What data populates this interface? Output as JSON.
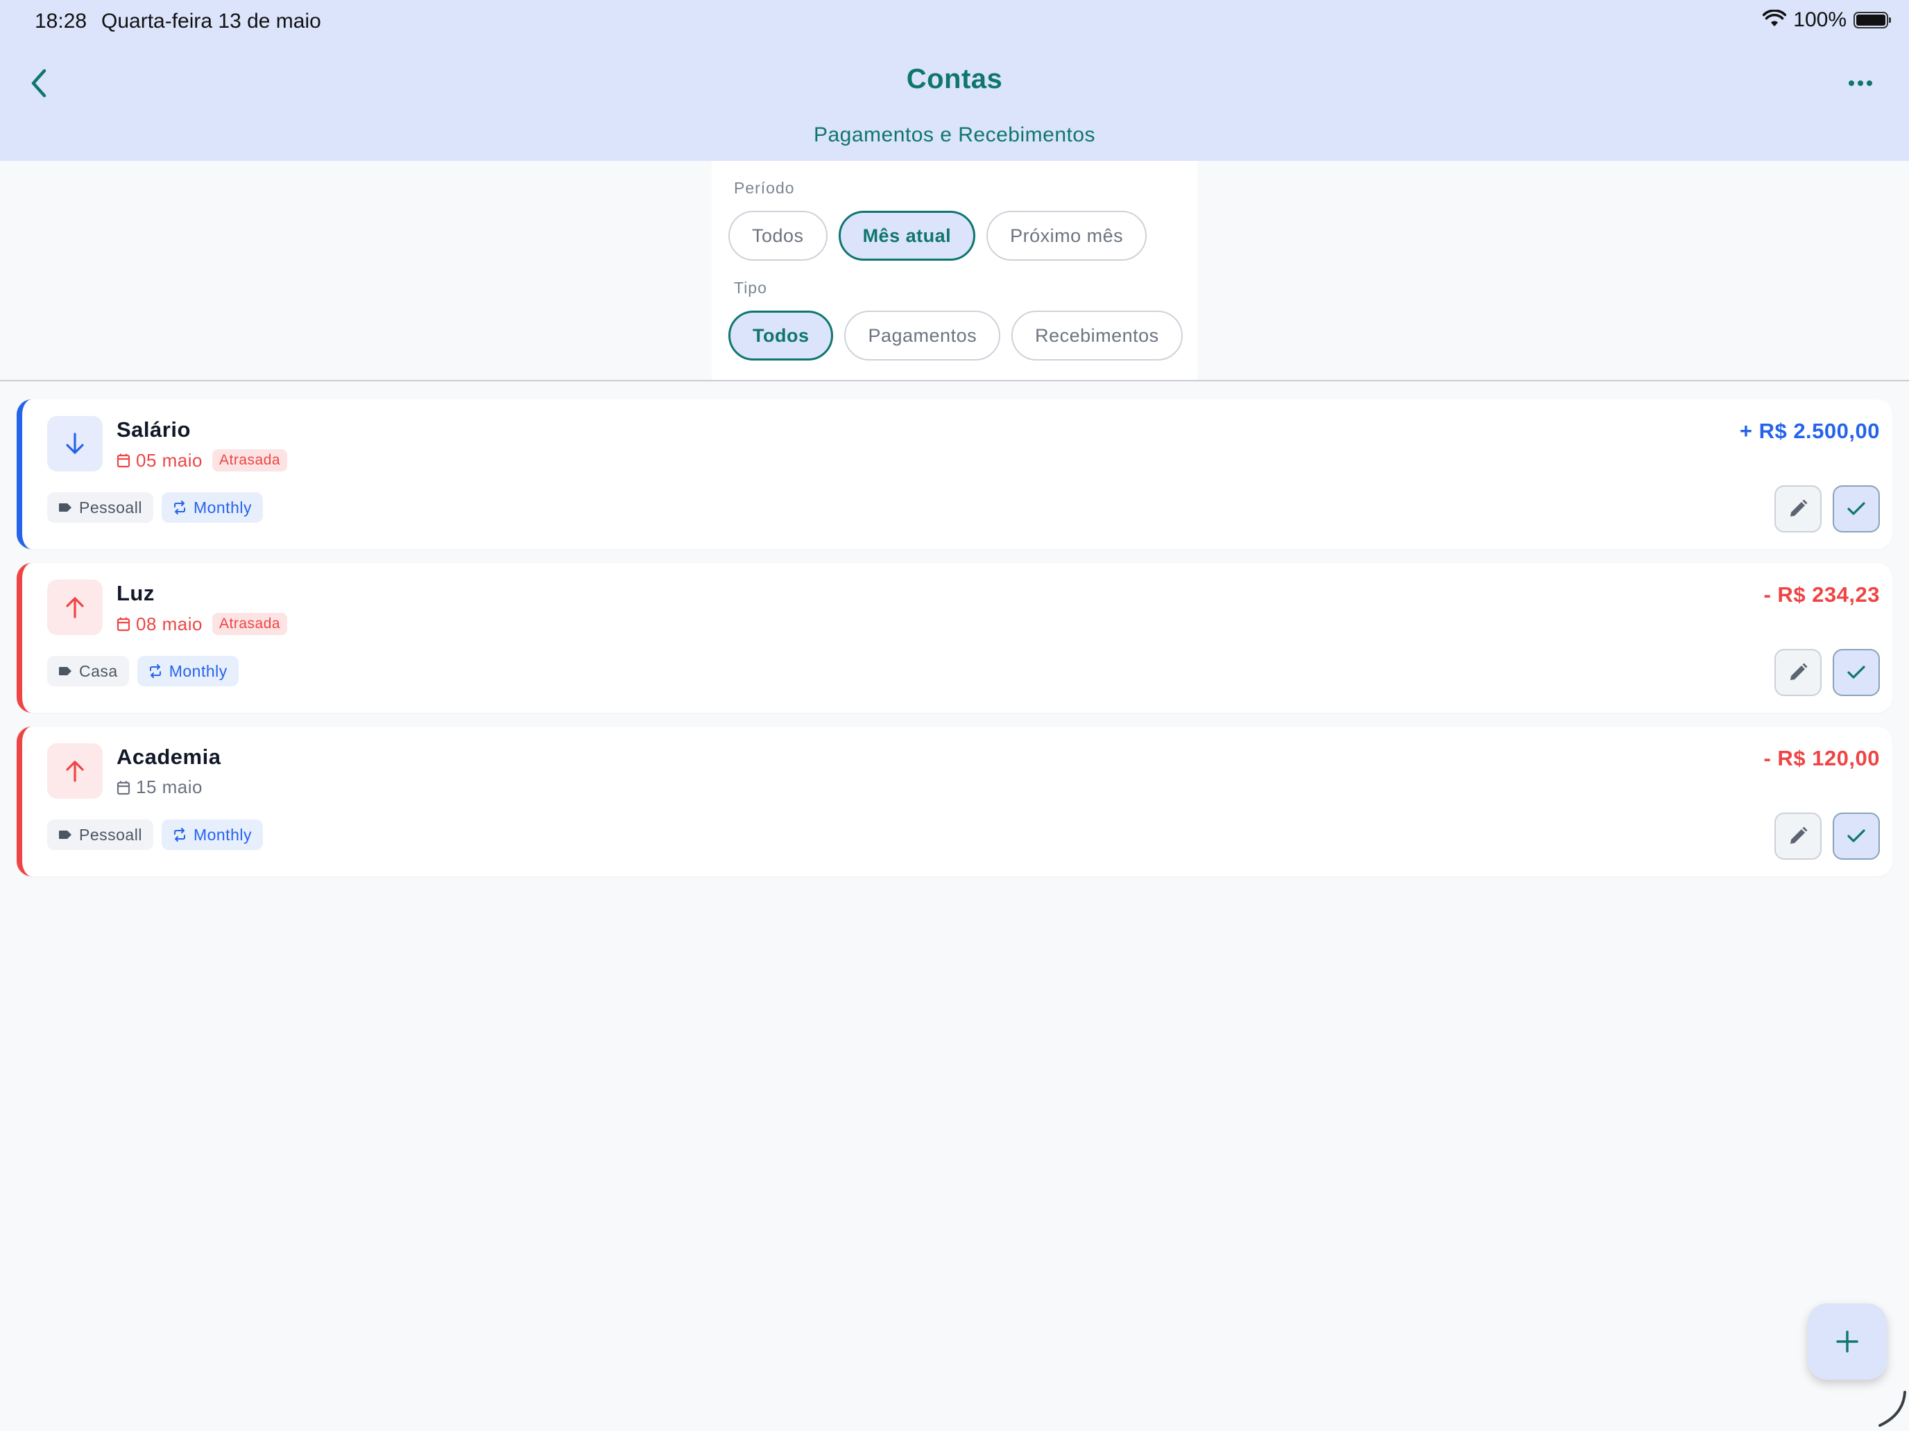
{
  "status_bar": {
    "time": "18:28",
    "date": "Quarta-feira 13 de maio",
    "battery": "100%"
  },
  "header": {
    "title": "Contas",
    "subtitle": "Pagamentos e Recebimentos",
    "back_icon": "chevron-left-icon",
    "more_icon": "more-horizontal-icon"
  },
  "filters": {
    "period": {
      "label": "Período",
      "options": [
        "Todos",
        "Mês atual",
        "Próximo mês"
      ],
      "selected": "Mês atual"
    },
    "type": {
      "label": "Tipo",
      "options": [
        "Todos",
        "Pagamentos",
        "Recebimentos"
      ],
      "selected": "Todos"
    }
  },
  "bills": [
    {
      "title": "Salário",
      "date": "05 maio",
      "status": "Atrasada",
      "amount": "+ R$ 2.500,00",
      "kind": "income",
      "category": "Pessoall",
      "recurrence": "Monthly"
    },
    {
      "title": "Luz",
      "date": "08 maio",
      "status": "Atrasada",
      "amount": "- R$ 234,23",
      "kind": "expense",
      "category": "Casa",
      "recurrence": "Monthly"
    },
    {
      "title": "Academia",
      "date": "15 maio",
      "status": "",
      "amount": "- R$ 120,00",
      "kind": "expense",
      "category": "Pessoall",
      "recurrence": "Monthly"
    }
  ],
  "colors": {
    "accent": "#0f766e",
    "header_bg": "#dbe4fb",
    "income": "#2563eb",
    "expense": "#ef4444"
  },
  "fab": {
    "icon": "plus-icon"
  }
}
